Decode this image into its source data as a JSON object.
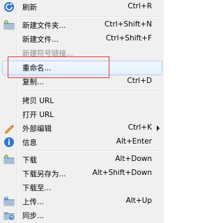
{
  "menu": {
    "items": [
      {
        "label": "刷新",
        "shortcut": "Ctrl+R",
        "icon": "refresh-icon"
      },
      {
        "label": "新建文件夹...",
        "shortcut": "Ctrl+Shift+N",
        "icon": "new-folder-icon"
      },
      {
        "label": "新建文件...",
        "shortcut": "Ctrl+Shift+F",
        "icon": ""
      },
      {
        "label": "新建符号链接...",
        "shortcut": "",
        "icon": "",
        "disabled": true
      },
      {
        "label": "重命名...",
        "shortcut": "",
        "icon": ""
      },
      {
        "label": "复制...",
        "shortcut": "Ctrl+D",
        "icon": ""
      },
      {
        "label": "拷贝 URL",
        "shortcut": "",
        "icon": ""
      },
      {
        "label": "打开 URL",
        "shortcut": "",
        "icon": ""
      },
      {
        "label": "外部编辑",
        "shortcut": "Ctrl+K",
        "icon": "pencil-icon",
        "submenu": true
      },
      {
        "label": "信息",
        "shortcut": "Alt+Enter",
        "icon": "info-icon"
      },
      {
        "label": "下载",
        "shortcut": "Alt+Down",
        "icon": "download-icon"
      },
      {
        "label": "下载另存为...",
        "shortcut": "Alt+Shift+Down",
        "icon": ""
      },
      {
        "label": "下载至...",
        "shortcut": "",
        "icon": ""
      },
      {
        "label": "上传...",
        "shortcut": "Alt+Up",
        "icon": "upload-icon"
      },
      {
        "label": "同步...",
        "shortcut": "",
        "icon": "sync-icon"
      }
    ]
  },
  "colors": {
    "highlight_border": "#aecff7",
    "annotation_red": "#e53a3a",
    "disabled_text": "#8d8d8d"
  }
}
